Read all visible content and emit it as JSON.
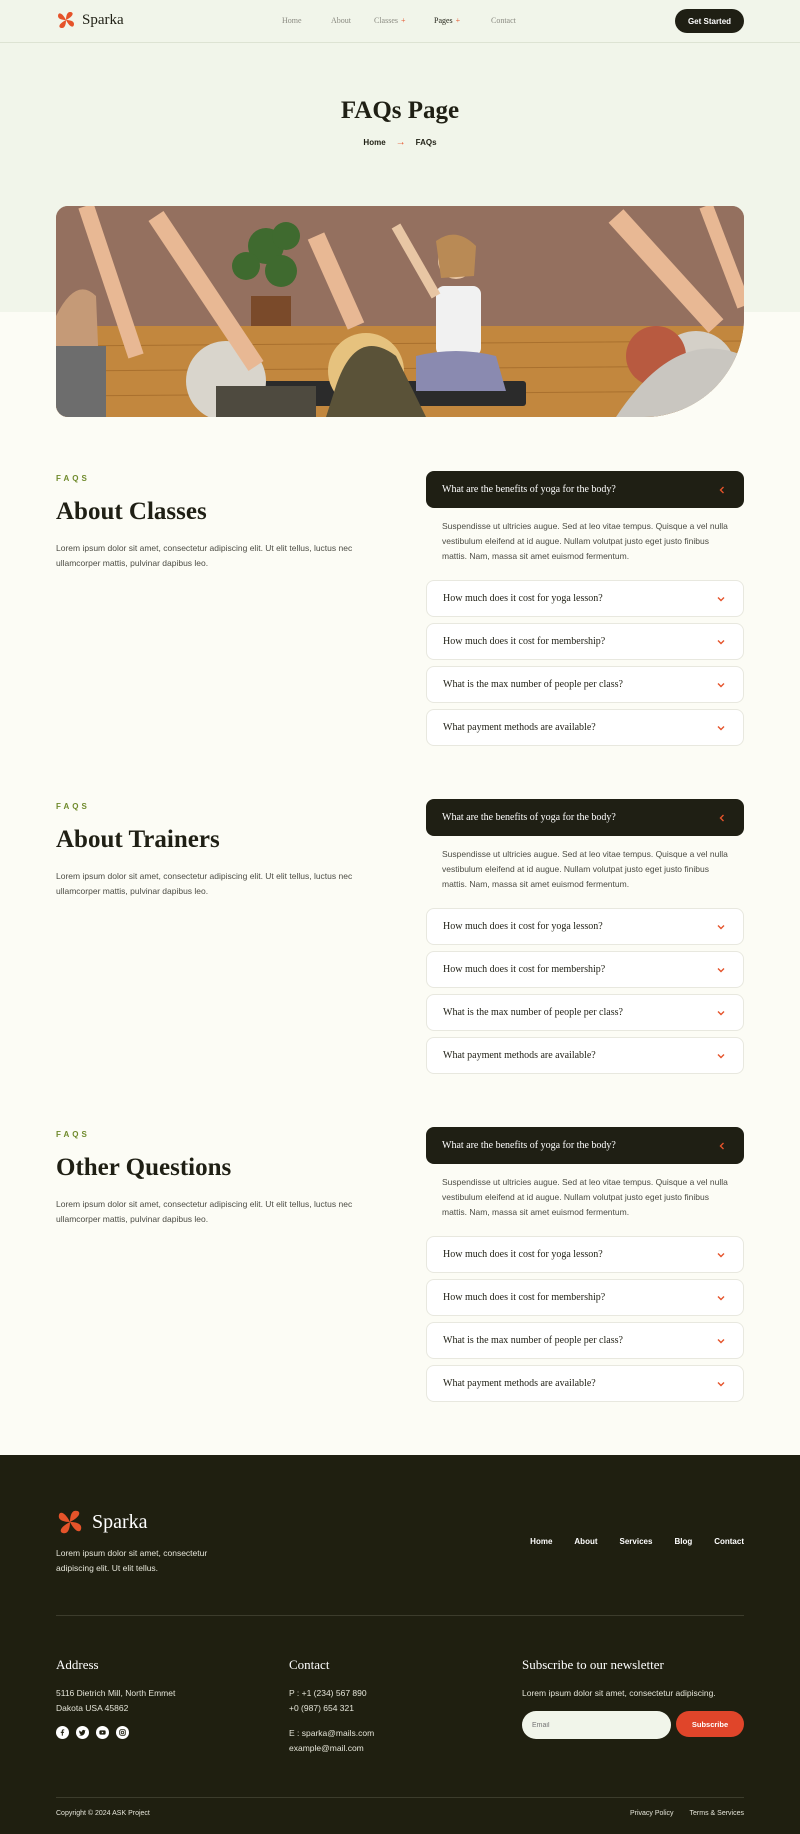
{
  "brand": {
    "name": "Sparka",
    "accent": "#e5532a",
    "dark": "#1f1f14",
    "mint": "#f1f5ea"
  },
  "nav": {
    "items": [
      {
        "label": "Home",
        "has_plus": false,
        "active": false
      },
      {
        "label": "About",
        "has_plus": false,
        "active": false
      },
      {
        "label": "Classes",
        "has_plus": true,
        "active": false
      },
      {
        "label": "Pages",
        "has_plus": true,
        "active": true
      },
      {
        "label": "Contact",
        "has_plus": false,
        "active": false
      }
    ],
    "cta": "Get Started"
  },
  "hero": {
    "title": "FAQs Page",
    "breadcrumb": [
      "Home",
      "FAQs"
    ]
  },
  "sections": [
    {
      "kicker": "FAQS",
      "title": "About Classes",
      "text": "Lorem ipsum dolor sit amet, consectetur adipiscing elit. Ut elit tellus, luctus nec ullamcorper mattis, pulvinar dapibus leo.",
      "open_question": "What are the benefits of yoga for the body?",
      "answer": "Suspendisse ut ultricies augue. Sed at leo vitae tempus. Quisque a vel nulla vestibulum eleifend at id augue. Nullam volutpat justo eget justo finibus mattis. Nam, massa sit amet euismod fermentum.",
      "questions": [
        "How much does it cost for yoga lesson?",
        "How much does it cost for membership?",
        "What is the max number of people per class?",
        "What payment methods are available?"
      ]
    },
    {
      "kicker": "FAQS",
      "title": "About Trainers",
      "text": "Lorem ipsum dolor sit amet, consectetur adipiscing elit. Ut elit tellus, luctus nec ullamcorper mattis, pulvinar dapibus leo.",
      "open_question": "What are the benefits of yoga for the body?",
      "answer": "Suspendisse ut ultricies augue. Sed at leo vitae tempus. Quisque a vel nulla vestibulum eleifend at id augue. Nullam volutpat justo eget justo finibus mattis. Nam, massa sit amet euismod fermentum.",
      "questions": [
        "How much does it cost for yoga lesson?",
        "How much does it cost for membership?",
        "What is the max number of people per class?",
        "What payment methods are available?"
      ]
    },
    {
      "kicker": "FAQS",
      "title": "Other Questions",
      "text": "Lorem ipsum dolor sit amet, consectetur adipiscing elit. Ut elit tellus, luctus nec ullamcorper mattis, pulvinar dapibus leo.",
      "open_question": "What are the benefits of yoga for the body?",
      "answer": "Suspendisse ut ultricies augue. Sed at leo vitae tempus. Quisque a vel nulla vestibulum eleifend at id augue. Nullam volutpat justo eget justo finibus mattis. Nam, massa sit amet euismod fermentum.",
      "questions": [
        "How much does it cost for yoga lesson?",
        "How much does it cost for membership?",
        "What is the max number of people per class?",
        "What payment methods are available?"
      ]
    }
  ],
  "footer": {
    "brand": "Sparka",
    "description": "Lorem ipsum dolor sit amet, consectetur adipiscing elit. Ut elit tellus.",
    "nav": [
      "Home",
      "About",
      "Services",
      "Blog",
      "Contact"
    ],
    "address_title": "Address",
    "address_line1": "5116 Dietrich Mill, North Emmet",
    "address_line2": "Dakota USA 45862",
    "contact_title": "Contact",
    "phone1": "P : +1 (234) 567 890",
    "phone2": "+0 (987) 654 321",
    "email1": "E : sparka@mails.com",
    "email2": "example@mail.com",
    "newsletter_title": "Subscribe to our newsletter",
    "newsletter_text": "Lorem ipsum dolor sit amet, consectetur adipiscing.",
    "email_placeholder": "Email",
    "subscribe": "Subscribe",
    "copyright": "Copyright © 2024 ASK Project",
    "privacy": "Privacy Policy",
    "terms": "Terms & Services",
    "socials": [
      "facebook-icon",
      "twitter-icon",
      "youtube-icon",
      "instagram-icon"
    ]
  }
}
